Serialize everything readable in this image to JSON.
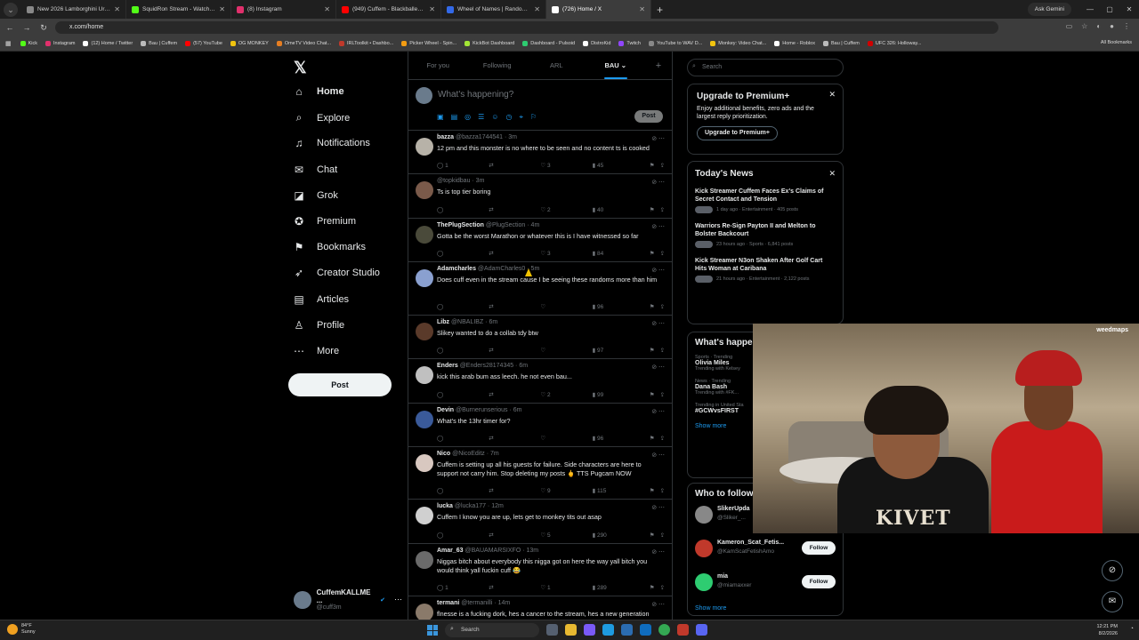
{
  "browser": {
    "tabs": [
      {
        "title": "New 2026 Lamborghini Urus SE",
        "color": "#888888"
      },
      {
        "title": "SquidRon Stream - Watch Live",
        "color": "#53fc18"
      },
      {
        "title": "(8) Instagram",
        "color": "#e1306c"
      },
      {
        "title": "(949) Cuffem - Blackballed (Si",
        "color": "#ff0000"
      },
      {
        "title": "Wheel of Names | Random nam",
        "color": "#3369e8"
      },
      {
        "title": "(726) Home / X",
        "color": "#ffffff"
      }
    ],
    "gemini_label": "Ask Gemini",
    "url": "x.com/home",
    "bookmarks": [
      "Kick",
      "Instagram",
      "(12) Home / Twitter",
      "Bau | Cuffem",
      "(57) YouTube",
      "OG MONKEY",
      "OmeTV Video Chat...",
      "IRLToolkit • Dashbo...",
      "Picker Wheel - Spin...",
      "KickBot Dashboard",
      "Dashboard - Pulsoid",
      "DistroKid",
      "Twitch",
      "YouTube to WAV D...",
      "Monkey: Video Chat...",
      "Home - Roblox",
      "Bau | Cuffem",
      "UFC 326: Holloway..."
    ],
    "all_bookmarks": "All Bookmarks"
  },
  "nav": {
    "logo": "𝕏",
    "items": [
      {
        "label": "Home",
        "icon": "⌂"
      },
      {
        "label": "Explore",
        "icon": "⌕"
      },
      {
        "label": "Notifications",
        "icon": "♫"
      },
      {
        "label": "Chat",
        "icon": "✉"
      },
      {
        "label": "Grok",
        "icon": "◪"
      },
      {
        "label": "Premium",
        "icon": "✪"
      },
      {
        "label": "Bookmarks",
        "icon": "⚑"
      },
      {
        "label": "Creator Studio",
        "icon": "➶"
      },
      {
        "label": "Articles",
        "icon": "▤"
      },
      {
        "label": "Profile",
        "icon": "♙"
      },
      {
        "label": "More",
        "icon": "⋯"
      }
    ],
    "post_label": "Post",
    "account": {
      "name": "CuffemKALLME ...",
      "handle": "@cuff3m"
    }
  },
  "feed": {
    "tabs": [
      "For you",
      "Following",
      "ARL",
      "BAU ⌄",
      "+"
    ],
    "composer_placeholder": "What's happening?",
    "composer_post": "Post",
    "tweets": [
      {
        "name": "bazza",
        "handle": "@bazza17445​41 · 3m",
        "text": "12 pm and this monster is no where to be seen and no content ts is cooked",
        "reply": "1",
        "like": "3",
        "views": "45",
        "h": 49
      },
      {
        "name": "",
        "handle": "@topkidbau · 3m",
        "text": "Ts is top tier boring",
        "reply": "",
        "like": "2",
        "views": "40",
        "h": 50
      },
      {
        "name": "ThePlugSection",
        "handle": "@PlugSection · 4m",
        "text": "Gotta be the worst Marathon or whatever this is I have witnessed so far",
        "reply": "",
        "like": "3",
        "views": "84",
        "h": 49
      },
      {
        "name": "Adamcharles",
        "handle": "@AdamCharles0 · 5m",
        "text": "Does cuff even in the stream cause I be seeing these randoms more than him",
        "reply": "",
        "like": "",
        "views": "96",
        "h": 60
      },
      {
        "name": "Libz",
        "handle": "@NBALIBZ · 6m",
        "text": "Slikey wanted to do a collab tdy btw",
        "reply": "",
        "like": "",
        "views": "97",
        "h": 49
      },
      {
        "name": "Enders",
        "handle": "@Enders28174345 · 6m",
        "text": "kick this arab bum ass leech. he not even bau...",
        "reply": "",
        "like": "2",
        "views": "99",
        "h": 50
      },
      {
        "name": "Devin",
        "handle": "@Burnerunserious · 6m",
        "text": "What's the 13hr timer for?",
        "reply": "",
        "like": "",
        "views": "96",
        "h": 49
      },
      {
        "name": "Nico",
        "handle": "@NicoEditz · 7m",
        "text": "Cuffem is setting up all his guests for failure.  Side characters are here to support not carry him. Stop deleting my posts 🖕 TTS Pugcam NOW",
        "reply": "",
        "like": "9",
        "views": "115",
        "h": 59
      },
      {
        "name": "lucka",
        "handle": "@lucka177 · 12m",
        "text": "Cuffem I know you are up, lets get to monkey tits out asap",
        "reply": "",
        "like": "5",
        "views": "290",
        "h": 50
      },
      {
        "name": "Amar_63",
        "handle": "@BAUAMARSIXFO · 13m",
        "text": "Niggas bitch about everybody this nigga got on here the way yall bitch you would think yall fuckin cuff 😂",
        "reply": "1",
        "like": "1",
        "views": "289",
        "h": 59
      },
      {
        "name": "termani",
        "handle": "@termanilli · 14m",
        "text": "flnesse is a fucking dork, hes a cancer to the stream, hes a new generation",
        "reply": "",
        "like": "",
        "views": "",
        "h": 40
      }
    ]
  },
  "right": {
    "search_placeholder": "Search",
    "premium": {
      "title": "Upgrade to Premium+",
      "desc": "Enjoy additional benefits, zero ads and the largest reply prioritization.",
      "button": "Upgrade to Premium+"
    },
    "news": {
      "title": "Today's News",
      "items": [
        {
          "title": "Kick Streamer Cuffem Faces Ex's Claims of Secret Contact and Tension",
          "meta": "1 day ago · Entertainment · 405 posts"
        },
        {
          "title": "Warriors Re-Sign Payton II and Melton to Bolster Backcourt",
          "meta": "23 hours ago · Sports · 6,841 posts"
        },
        {
          "title": "Kick Streamer N3on Shaken After Golf Cart Hits Woman at Caribana",
          "meta": "21 hours ago · Entertainment · 2,122 posts"
        }
      ]
    },
    "happening": {
      "title": "What's happe",
      "trends": [
        {
          "cat": "Sports · Trending",
          "name": "Olivia Miles",
          "sub": "Trending with Kelsey"
        },
        {
          "cat": "News · Trending",
          "name": "Dana Bash",
          "sub": "Trending with #FK..."
        },
        {
          "cat": "Trending in United Sta",
          "name": "#GCWvsFIRST",
          "sub": ""
        }
      ],
      "show_more": "Show more"
    },
    "who": {
      "title": "Who to follow",
      "users": [
        {
          "name": "SlikerUpda",
          "handle": "@Sliker_...",
          "btn": ""
        },
        {
          "name": "Kameron_Scat_Fetis...",
          "handle": "@KamScatFetishAmo",
          "btn": "Follow"
        },
        {
          "name": "mia",
          "handle": "@miamaxxer",
          "btn": "Follow"
        }
      ],
      "show_more": "Show more"
    }
  },
  "video": {
    "shirt_text": "KIVET",
    "logo": "weedmaps"
  },
  "taskbar": {
    "weather_temp": "84°F",
    "weather_cond": "Sunny",
    "search": "Search",
    "time": "12:21 PM",
    "date": "8/2/2026"
  }
}
